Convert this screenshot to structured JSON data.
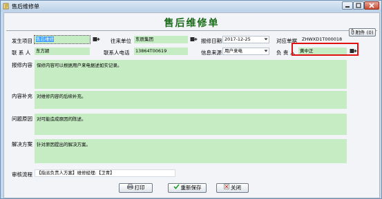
{
  "window": {
    "title": "售后维修单"
  },
  "form": {
    "title": "售后维修单"
  },
  "header_fields": {
    "project_label": "发生项目",
    "project_value": "售后维修",
    "company_label": "往来单位",
    "company_value": "东辰集团",
    "date_label": "报修日期",
    "date_value": "2017-12-25",
    "order_label": "对应单据",
    "order_value": "ZHWXD1T000018",
    "attachment_label": "附件 (0)",
    "contact_label": "联 系 人",
    "contact_value": "东方颖",
    "phone_label": "联系人电话",
    "phone_value": "13864T00619",
    "source_label": "信息来源",
    "source_value": "用户来电",
    "owner_label": "负 责 人",
    "owner_value": "黄中正"
  },
  "sections": [
    {
      "label": "报修内容",
      "text": "保修内容可以根据用户来电据述如实记录。"
    },
    {
      "label": "内容补充",
      "text": "对维修内容的后续补充。"
    },
    {
      "label": "问题原因",
      "text": "对可能造成原因的陈述。"
    },
    {
      "label": "解决方案",
      "text": "针对原因提出的解决方案。"
    }
  ],
  "approval": {
    "label": "审核流程",
    "value": "【指派负责人方案】维修经理:【卫青】"
  },
  "buttons": {
    "print": "打印",
    "resave": "重新保存",
    "close": "关闭"
  },
  "colors": {
    "field_green": "#c5ecc2",
    "title_green": "#1a6a1a",
    "highlight": "#e01010"
  }
}
